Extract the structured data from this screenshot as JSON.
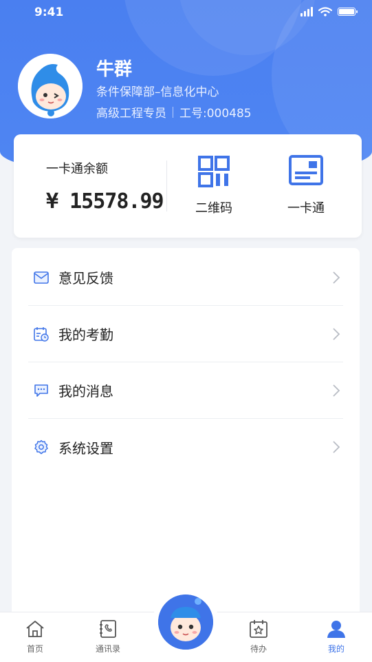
{
  "status_bar": {
    "time": "9:41"
  },
  "profile": {
    "name": "牛群",
    "department": "条件保障部–信息化中心",
    "title": "高级工程专员",
    "employee_id": "工号:000485"
  },
  "card": {
    "balance_label": "一卡通余额",
    "balance_value": "¥ 15578.99",
    "quick_actions": [
      {
        "label": "二维码",
        "icon": "qr-code-icon"
      },
      {
        "label": "一卡通",
        "icon": "card-icon"
      }
    ]
  },
  "menu": [
    {
      "label": "意见反馈",
      "icon": "mail-icon"
    },
    {
      "label": "我的考勤",
      "icon": "calendar-clock-icon"
    },
    {
      "label": "我的消息",
      "icon": "chat-icon"
    },
    {
      "label": "系统设置",
      "icon": "gear-icon"
    }
  ],
  "tabbar": {
    "tabs": [
      {
        "label": "首页",
        "icon": "home-icon"
      },
      {
        "label": "通讯录",
        "icon": "contacts-icon"
      },
      {
        "label": "待办",
        "icon": "todo-icon"
      },
      {
        "label": "我的",
        "icon": "user-icon"
      }
    ],
    "active": "我的",
    "center_icon": "mascot-icon"
  },
  "colors": {
    "primary": "#4a7ff0",
    "active_tab": "#3f74e8"
  }
}
